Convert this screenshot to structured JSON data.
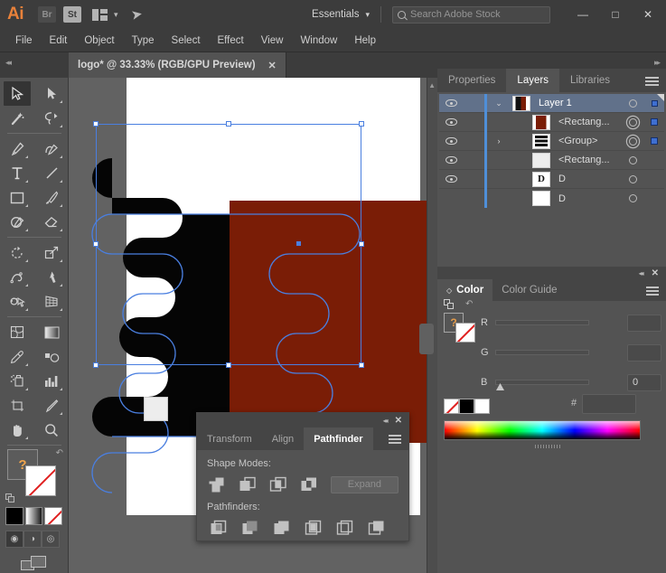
{
  "app": {
    "name": "Ai",
    "mini_apps": [
      {
        "name": "Br",
        "label": "Br"
      },
      {
        "name": "St",
        "label": "St"
      }
    ],
    "workspace": "Essentials",
    "search_placeholder": "Search Adobe Stock",
    "window_buttons": {
      "minimize": "—",
      "maximize": "□",
      "close": "✕"
    }
  },
  "menubar": {
    "items": [
      "File",
      "Edit",
      "Object",
      "Type",
      "Select",
      "Effect",
      "View",
      "Window",
      "Help"
    ]
  },
  "document": {
    "tab_title": "logo* @ 33.33% (RGB/GPU Preview)",
    "close_label": "✕",
    "zoom": "33.33%",
    "color_mode": "RGB/GPU Preview",
    "name": "logo",
    "modified": true
  },
  "toolbar": {
    "tools": [
      {
        "name": "selection-tool",
        "label": "Selection",
        "selected": true
      },
      {
        "name": "direct-selection-tool",
        "label": "Direct Selection",
        "selected": false
      },
      {
        "name": "magic-wand-tool",
        "label": "Magic Wand",
        "selected": false
      },
      {
        "name": "lasso-tool",
        "label": "Lasso",
        "selected": false
      },
      {
        "name": "pen-tool",
        "label": "Pen",
        "selected": false
      },
      {
        "name": "curvature-tool",
        "label": "Curvature",
        "selected": false
      },
      {
        "name": "type-tool",
        "label": "Type",
        "selected": false
      },
      {
        "name": "line-segment-tool",
        "label": "Line Segment",
        "selected": false
      },
      {
        "name": "rectangle-tool",
        "label": "Rectangle",
        "selected": false
      },
      {
        "name": "paintbrush-tool",
        "label": "Paintbrush",
        "selected": false
      },
      {
        "name": "shaper-tool",
        "label": "Shaper",
        "selected": false
      },
      {
        "name": "eraser-tool",
        "label": "Eraser",
        "selected": false
      },
      {
        "name": "rotate-tool",
        "label": "Rotate",
        "selected": false
      },
      {
        "name": "scale-tool",
        "label": "Scale",
        "selected": false
      },
      {
        "name": "width-tool",
        "label": "Width",
        "selected": false
      },
      {
        "name": "free-transform-tool",
        "label": "Free Transform",
        "selected": false
      },
      {
        "name": "shape-builder-tool",
        "label": "Shape Builder",
        "selected": false
      },
      {
        "name": "perspective-grid-tool",
        "label": "Perspective Grid",
        "selected": false
      },
      {
        "name": "mesh-tool",
        "label": "Mesh",
        "selected": false
      },
      {
        "name": "gradient-tool",
        "label": "Gradient",
        "selected": false
      },
      {
        "name": "eyedropper-tool",
        "label": "Eyedropper",
        "selected": false
      },
      {
        "name": "blend-tool",
        "label": "Blend",
        "selected": false
      },
      {
        "name": "symbol-sprayer-tool",
        "label": "Symbol Sprayer",
        "selected": false
      },
      {
        "name": "column-graph-tool",
        "label": "Column Graph",
        "selected": false
      },
      {
        "name": "artboard-tool",
        "label": "Artboard",
        "selected": false
      },
      {
        "name": "slice-tool",
        "label": "Slice",
        "selected": false
      },
      {
        "name": "hand-tool",
        "label": "Hand",
        "selected": false
      },
      {
        "name": "zoom-tool",
        "label": "Zoom",
        "selected": false
      }
    ],
    "fill_label": "?",
    "draw_modes": [
      "draw-normal",
      "draw-behind",
      "draw-inside"
    ],
    "active_draw_mode": "draw-normal"
  },
  "layers_panel": {
    "tabs": [
      {
        "label": "Properties",
        "active": false
      },
      {
        "label": "Layers",
        "active": true
      },
      {
        "label": "Libraries",
        "active": false
      }
    ],
    "rows": [
      {
        "name": "Layer 1",
        "thumb": "th-l1",
        "visible": true,
        "selected": true,
        "expanded": true,
        "arrow": "⌄",
        "target": "single",
        "has_selection_square": true,
        "indent": 0
      },
      {
        "name": "<Rectang...",
        "thumb": "th-rect",
        "visible": true,
        "selected": false,
        "expanded": false,
        "arrow": "",
        "target": "double",
        "has_selection_square": true,
        "indent": 1
      },
      {
        "name": "<Group>",
        "thumb": "th-grp",
        "visible": true,
        "selected": false,
        "expanded": false,
        "arrow": "›",
        "target": "double",
        "has_selection_square": true,
        "indent": 1
      },
      {
        "name": "<Rectang...",
        "thumb": "th-white",
        "visible": true,
        "selected": false,
        "expanded": false,
        "arrow": "",
        "target": "single",
        "has_selection_square": false,
        "indent": 1
      },
      {
        "name": "D",
        "thumb": "th-D",
        "visible": true,
        "selected": false,
        "expanded": false,
        "arrow": "",
        "target": "single",
        "has_selection_square": false,
        "indent": 1
      },
      {
        "name": "D",
        "thumb": "th-Dw",
        "visible": false,
        "selected": false,
        "expanded": false,
        "arrow": "",
        "target": "single",
        "has_selection_square": false,
        "indent": 1
      }
    ]
  },
  "color_panel": {
    "tabs": [
      {
        "label": "Color",
        "active": true
      },
      {
        "label": "Color Guide",
        "active": false
      }
    ],
    "sliders": [
      {
        "label": "R",
        "value": "",
        "knob_pct": 0
      },
      {
        "label": "G",
        "value": "",
        "knob_pct": 0
      },
      {
        "label": "B",
        "value": "0",
        "knob_pct": 0
      }
    ],
    "hex_label": "#",
    "hex_value": "",
    "fill_label": "?",
    "swatch_none_label": "",
    "swatch_black_label": "",
    "swatch_white_label": ""
  },
  "pathfinder_panel": {
    "tabs": [
      {
        "label": "Transform",
        "active": false
      },
      {
        "label": "Align",
        "active": false
      },
      {
        "label": "Pathfinder",
        "active": true
      }
    ],
    "shape_modes_label": "Shape Modes:",
    "pathfinders_label": "Pathfinders:",
    "expand_label": "Expand",
    "shape_modes": [
      "unite",
      "minus-front",
      "intersect",
      "exclude"
    ],
    "pathfinders": [
      "divide",
      "trim",
      "merge",
      "crop",
      "outline",
      "minus-back"
    ],
    "collapse_label": "◂◂",
    "close_label": "✕"
  },
  "colors": {
    "artwork_red": "#7A1D06",
    "artwork_black": "#050505",
    "selection_blue": "#4A7FE0",
    "panel_bg": "#535353",
    "panel_tab_bg": "#454545",
    "canvas_bg": "#626262",
    "accent_orange": "#E8813A",
    "layer_highlight": "#61718A"
  },
  "canvas": {
    "artboard_visible": true,
    "selection_active": true,
    "small_square_label": ""
  }
}
